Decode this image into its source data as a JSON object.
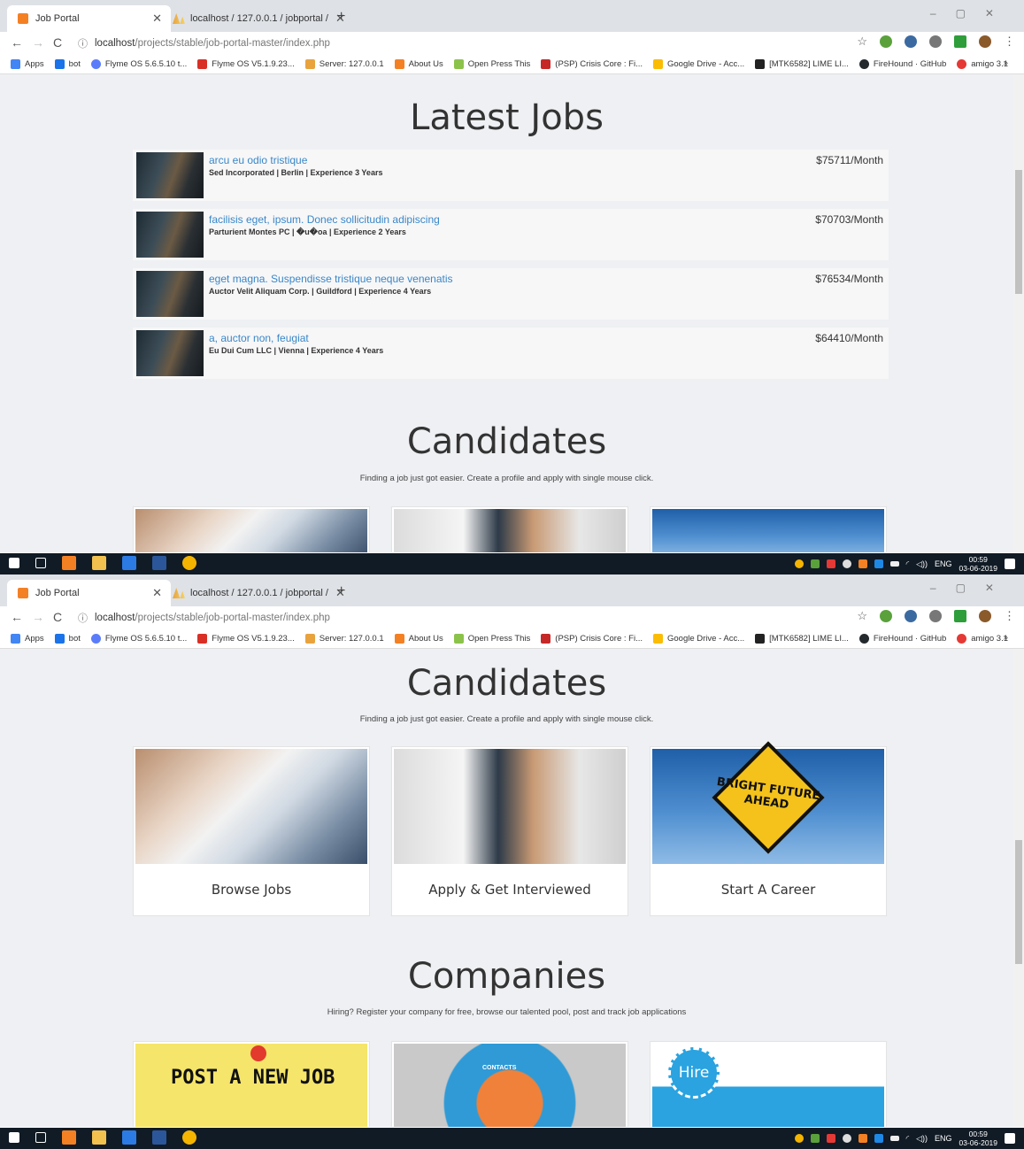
{
  "browser": {
    "tab_title": "Job Portal",
    "tab2_title": "localhost / 127.0.0.1 / jobportal /",
    "url_host": "localhost",
    "url_path": "/projects/stable/job-portal-master/index.php"
  },
  "bookmarks": [
    {
      "label": "Apps",
      "color": "#4285f4"
    },
    {
      "label": "bot",
      "color": "#1a73e8"
    },
    {
      "label": "Flyme OS 5.6.5.10 t...",
      "color": "#5b7cfa"
    },
    {
      "label": "Flyme OS V5.1.9.23...",
      "color": "#d93025"
    },
    {
      "label": "Server: 127.0.0.1",
      "color": "#e8a33d"
    },
    {
      "label": "About Us",
      "color": "#f48024"
    },
    {
      "label": "Open Press This",
      "color": "#8bc34a"
    },
    {
      "label": "(PSP) Crisis Core : Fi...",
      "color": "#c62828"
    },
    {
      "label": "Google Drive - Acc...",
      "color": "#fbbc04"
    },
    {
      "label": "[MTK6582] LIME LI...",
      "color": "#222222"
    },
    {
      "label": "FireHound · GitHub",
      "color": "#24292e"
    },
    {
      "label": "amigo 3.1",
      "color": "#e53935"
    }
  ],
  "latest_jobs": {
    "title": "Latest Jobs",
    "jobs": [
      {
        "title": "arcu eu odio tristique",
        "meta": "Sed Incorporated | Berlin | Experience 3 Years",
        "salary": "$75711/Month"
      },
      {
        "title": "facilisis eget, ipsum. Donec sollicitudin adipiscing",
        "meta": "Parturient Montes PC | �u�oa | Experience 2 Years",
        "salary": "$70703/Month"
      },
      {
        "title": "eget magna. Suspendisse tristique neque venenatis",
        "meta": "Auctor Velit Aliquam Corp. | Guildford | Experience 4 Years",
        "salary": "$76534/Month"
      },
      {
        "title": "a, auctor non, feugiat",
        "meta": "Eu Dui Cum LLC | Vienna | Experience 4 Years",
        "salary": "$64410/Month"
      }
    ]
  },
  "candidates": {
    "title": "Candidates",
    "subtitle": "Finding a job just got easier. Create a profile and apply with single mouse click.",
    "cards": [
      {
        "label": "Browse Jobs"
      },
      {
        "label": "Apply & Get Interviewed"
      },
      {
        "label": "Start A Career",
        "sign_text": "BRIGHT FUTURE AHEAD"
      }
    ]
  },
  "companies": {
    "title": "Companies",
    "subtitle": "Hiring? Register your company for free, browse our talented pool, post and track job applications",
    "card_texts": {
      "post_job": "POST A NEW JOB",
      "contacts": "CONTACTS",
      "hire": "Hire"
    }
  },
  "taskbar": {
    "time": "00:59",
    "date": "03-06-2019",
    "lang": "ENG"
  }
}
